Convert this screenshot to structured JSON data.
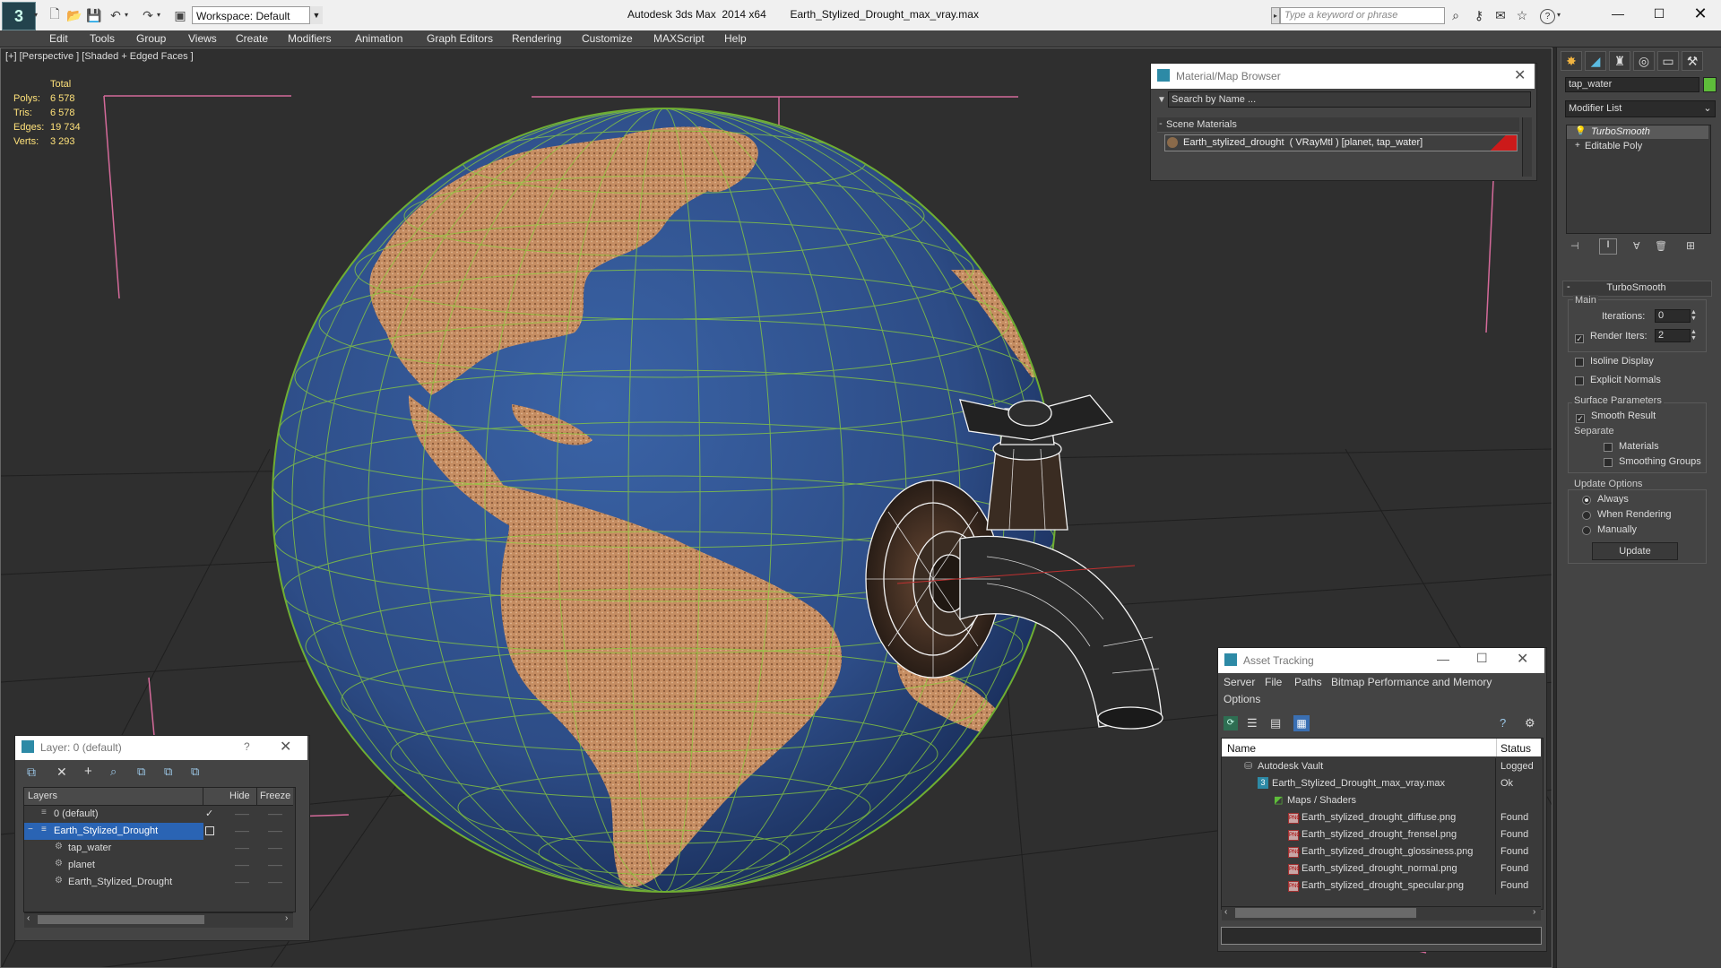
{
  "title_bar": {
    "app_name": "Autodesk 3ds Max  2014 x64",
    "file_name": "Earth_Stylized_Drought_max_vray.max",
    "workspace_label": "Workspace: Default",
    "search_placeholder": "Type a keyword or phrase"
  },
  "menu": [
    "Edit",
    "Tools",
    "Group",
    "Views",
    "Create",
    "Modifiers",
    "Animation",
    "Graph Editors",
    "Rendering",
    "Customize",
    "MAXScript",
    "Help"
  ],
  "viewport": {
    "label": "[+] [Perspective ] [Shaded + Edged Faces ]",
    "stats": {
      "header": "Total",
      "rows": [
        {
          "label": "Polys:",
          "value": "6 578"
        },
        {
          "label": "Tris:",
          "value": "6 578"
        },
        {
          "label": "Edges:",
          "value": "19 734"
        },
        {
          "label": "Verts:",
          "value": "3 293"
        }
      ]
    }
  },
  "material_browser": {
    "title": "Material/Map Browser",
    "search_placeholder": "Search by Name ...",
    "section": "Scene Materials",
    "material": "Earth_stylized_drought  ( VRayMtl ) [planet, tap_water]"
  },
  "command_panel": {
    "object_name": "tap_water",
    "modifier_list": "Modifier List",
    "stack": [
      "TurboSmooth",
      "Editable Poly"
    ],
    "rollout_title": "TurboSmooth",
    "main_group": "Main",
    "iterations_label": "Iterations:",
    "iterations_value": "0",
    "render_iters_label": "Render Iters:",
    "render_iters_value": "2",
    "isoline_label": "Isoline Display",
    "explicit_normals_label": "Explicit Normals",
    "surface_group": "Surface Parameters",
    "smooth_result_label": "Smooth Result",
    "separate_label": "Separate",
    "materials_label": "Materials",
    "smoothing_groups_label": "Smoothing Groups",
    "update_group": "Update Options",
    "always_label": "Always",
    "when_rendering_label": "When Rendering",
    "manually_label": "Manually",
    "update_button": "Update"
  },
  "layer_panel": {
    "title": "Layer: 0 (default)",
    "help": "?",
    "columns": [
      "Layers",
      "Hide",
      "Freeze"
    ],
    "rows": [
      "0 (default)",
      "Earth_Stylized_Drought",
      "tap_water",
      "planet",
      "Earth_Stylized_Drought"
    ]
  },
  "asset_tracking": {
    "title": "Asset Tracking",
    "menu": [
      "Server",
      "File",
      "Paths",
      "Bitmap Performance and Memory",
      "Options"
    ],
    "columns": [
      "Name",
      "Status"
    ],
    "rows": [
      {
        "name": "Autodesk Vault",
        "status": "Logged"
      },
      {
        "name": "Earth_Stylized_Drought_max_vray.max",
        "status": "Ok"
      },
      {
        "name": "Maps / Shaders",
        "status": ""
      },
      {
        "name": "Earth_stylized_drought_diffuse.png",
        "status": "Found"
      },
      {
        "name": "Earth_stylized_drought_frensel.png",
        "status": "Found"
      },
      {
        "name": "Earth_stylized_drought_glossiness.png",
        "status": "Found"
      },
      {
        "name": "Earth_stylized_drought_normal.png",
        "status": "Found"
      },
      {
        "name": "Earth_stylized_drought_specular.png",
        "status": "Found"
      }
    ]
  },
  "colors": {
    "ocean": "#2f4f86",
    "land": "#c9926a",
    "wire": "#7fc63a",
    "selection": "#2a64b4"
  }
}
